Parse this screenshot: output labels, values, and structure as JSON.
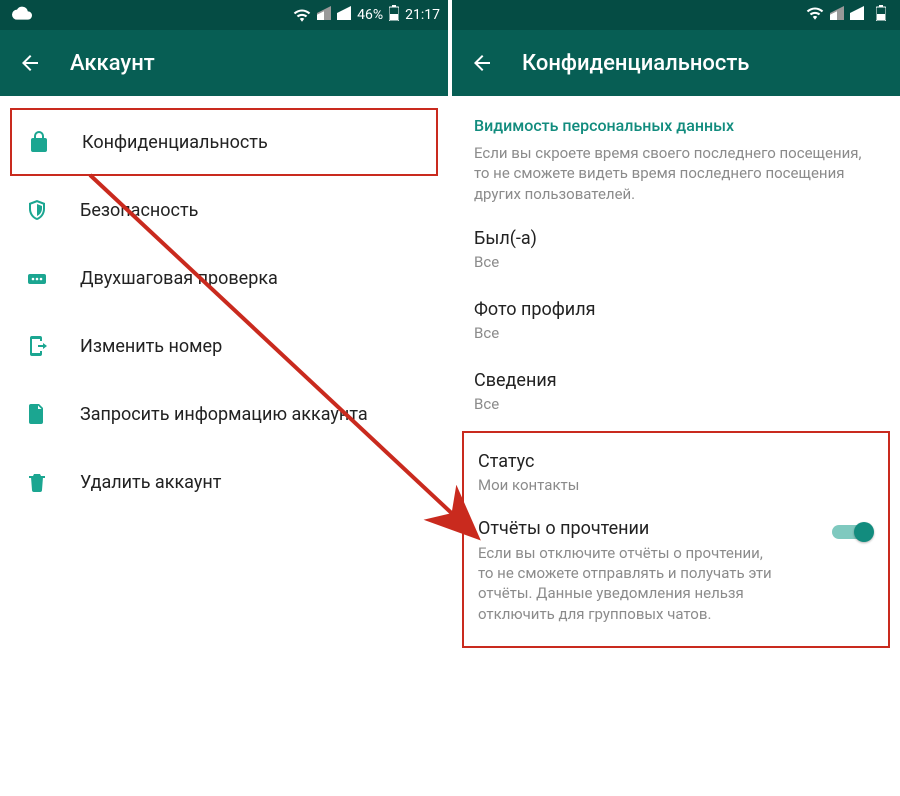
{
  "left": {
    "status": {
      "battery": "46%",
      "time": "21:17"
    },
    "appbar_title": "Аккаунт",
    "items": [
      {
        "label": "Конфиденциальность"
      },
      {
        "label": "Безопасность"
      },
      {
        "label": "Двухшаговая проверка"
      },
      {
        "label": "Изменить номер"
      },
      {
        "label": "Запросить информацию аккаунта"
      },
      {
        "label": "Удалить аккаунт"
      }
    ]
  },
  "right": {
    "status": {
      "title": "Статус",
      "value": "Мои контакты"
    },
    "appbar_title": "Конфиденциальность",
    "section_header": "Видимость персональных данных",
    "section_desc": "Если вы скроете время своего последнего посещения, то не сможете видеть время последнего посещения других пользователей.",
    "last_seen": {
      "title": "Был(-а)",
      "value": "Все"
    },
    "photo": {
      "title": "Фото профиля",
      "value": "Все"
    },
    "about": {
      "title": "Сведения",
      "value": "Все"
    },
    "receipts": {
      "title": "Отчёты о прочтении",
      "desc": "Если вы отключите отчёты о прочтении, то не сможете отправлять и получать эти отчёты. Данные уведомления нельзя отключить для групповых чатов."
    }
  }
}
